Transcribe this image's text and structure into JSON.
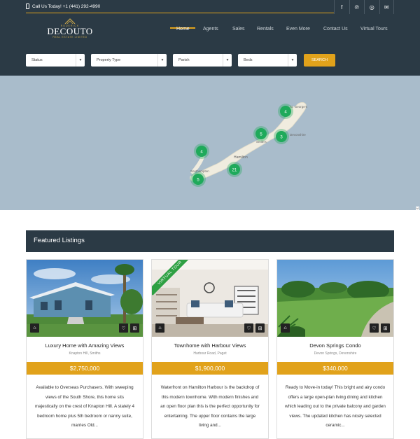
{
  "header": {
    "phone": "Call Us Today! +1 (441) 292-4990",
    "socials": [
      {
        "icon": "facebook-icon",
        "glyph": "f"
      },
      {
        "icon": "pinterest-icon",
        "glyph": "℗"
      },
      {
        "icon": "instagram-icon",
        "glyph": "◎"
      },
      {
        "icon": "mail-icon",
        "glyph": "✉"
      }
    ],
    "logo": {
      "top": "RODERICK",
      "name": "DECOUTO",
      "sub": "REAL ESTATE LIMITED"
    },
    "nav": [
      "Home",
      "Agents",
      "Sales",
      "Rentals",
      "Even More",
      "Contact Us",
      "Virtual Tours"
    ],
    "active_nav": "Home"
  },
  "filters": {
    "status": "Status",
    "property_type": "Property Type",
    "parish": "Parish",
    "beds": "Beds",
    "search": "SEARCH"
  },
  "map": {
    "clusters": [
      "4",
      "5",
      "3",
      "4",
      "21",
      "5"
    ],
    "labels": [
      "St. George's",
      "Devonshire",
      "Smith's",
      "Hamilton",
      "Southampton"
    ],
    "corner": "M"
  },
  "featured": {
    "heading": "Featured Listings",
    "listings": [
      {
        "title": "Luxury Home with Amazing Views",
        "address": "Knapton Hill, Smiths",
        "price": "$2,750,000",
        "desc": "Available to Overseas Purchasers. With sweeping views of the South Shore, this home sits majestically on the crest of Knapton Hill. A stately 4 bedroom home plus 5th bedroom or nanny suite, marries Old..."
      },
      {
        "title": "Townhome with Harbour Views",
        "address": "Harbour Road, Paget",
        "price": "$1,900,000",
        "ribbon": "VIRTUAL TOUR",
        "desc": "Waterfront on Hamilton Harbour is the backdrop of this modern townhome. With modern finishes and an open floor plan this is the perfect opportunity for entertaining. The upper floor contains the large living and..."
      },
      {
        "title": "Devon Springs Condo",
        "address": "Devon Springs, Devonshire",
        "price": "$340,000",
        "desc": "Ready to Move-in today! This bright and airy condo offers a large open-plan living dining and kitchen which leading out to the private balcony and garden views. The updated kitchen has nicely selected ceramic..."
      }
    ]
  },
  "colors": {
    "accent": "#e1a21b",
    "header": "#2b3a45",
    "map_water": "#a9bccb",
    "cluster": "#1faa5b"
  }
}
